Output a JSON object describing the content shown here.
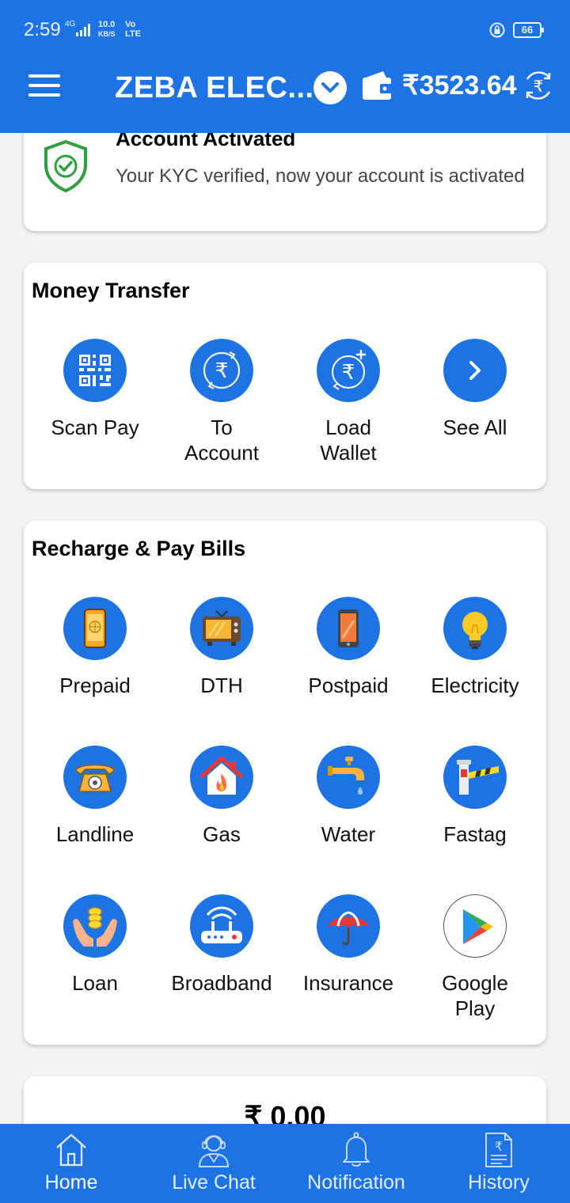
{
  "status_bar": {
    "time": "2:59",
    "network": "4G",
    "speed_value": "10.0",
    "speed_unit": "KB/S",
    "carrier_top": "Vo",
    "carrier_bottom": "LTE",
    "battery": "66"
  },
  "header": {
    "title": "ZEBA ELEC...",
    "balance": "₹3523.64"
  },
  "kyc": {
    "title": "Account Activated",
    "text": "Your KYC verified, now your account is activated"
  },
  "money_transfer": {
    "title": "Money Transfer",
    "items": [
      {
        "label": "Scan Pay",
        "icon": "qr-code-icon"
      },
      {
        "label": "To Account",
        "icon": "rupee-transfer-icon"
      },
      {
        "label": "Load Wallet",
        "icon": "rupee-add-icon"
      },
      {
        "label": "See All",
        "icon": "chevron-right-icon"
      }
    ]
  },
  "recharge": {
    "title": "Recharge & Pay Bills",
    "items": [
      {
        "label": "Prepaid",
        "icon": "mobile-icon"
      },
      {
        "label": "DTH",
        "icon": "tv-icon"
      },
      {
        "label": "Postpaid",
        "icon": "phone-icon"
      },
      {
        "label": "Electricity",
        "icon": "bulb-icon"
      },
      {
        "label": "Landline",
        "icon": "telephone-icon"
      },
      {
        "label": "Gas",
        "icon": "gas-house-icon"
      },
      {
        "label": "Water",
        "icon": "tap-icon"
      },
      {
        "label": "Fastag",
        "icon": "toll-barrier-icon"
      },
      {
        "label": "Loan",
        "icon": "loan-hands-icon"
      },
      {
        "label": "Broadband",
        "icon": "router-icon"
      },
      {
        "label": "Insurance",
        "icon": "umbrella-icon"
      },
      {
        "label": "Google Play",
        "icon": "google-play-icon"
      }
    ]
  },
  "balance_card": {
    "amount": "₹ 0.00"
  },
  "bottom_nav": {
    "items": [
      {
        "label": "Home",
        "icon": "home-icon"
      },
      {
        "label": "Live Chat",
        "icon": "support-agent-icon"
      },
      {
        "label": "Notification",
        "icon": "bell-icon"
      },
      {
        "label": "History",
        "icon": "receipt-icon"
      }
    ],
    "active": "Home"
  },
  "colors": {
    "primary": "#1e73e4",
    "shield_green": "#2e9e3e"
  }
}
